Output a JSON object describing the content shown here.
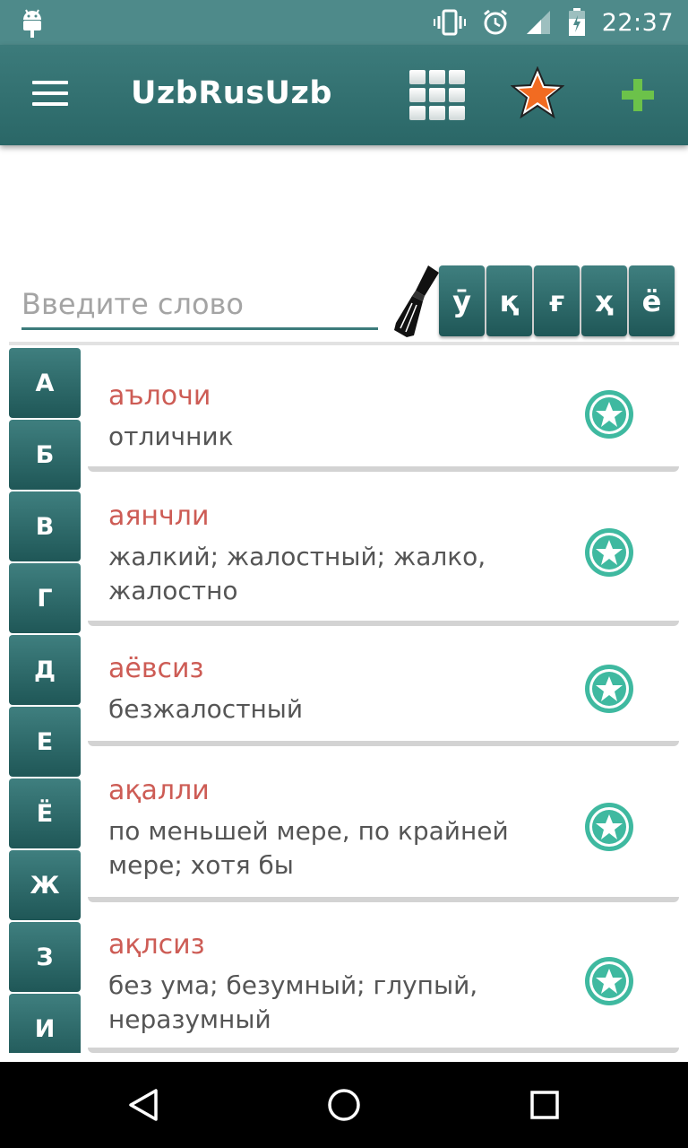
{
  "status_bar": {
    "time": "22:37",
    "icons": [
      "android-icon",
      "vibrate-icon",
      "alarm-icon",
      "signal-icon",
      "battery-icon"
    ]
  },
  "app_bar": {
    "title": "UzbRusUzb",
    "icons": [
      "menu-icon",
      "grid-icon",
      "favorites-star-icon",
      "add-plus-icon"
    ],
    "colors": {
      "bar": "#2f6d6d",
      "plus": "#6cc24a",
      "star": "#f26b21"
    }
  },
  "search": {
    "placeholder": "Введите слово",
    "value": "",
    "letter_keys": [
      "ӯ",
      "қ",
      "ғ",
      "ҳ",
      "ё"
    ]
  },
  "alphabet": [
    "А",
    "Б",
    "В",
    "Г",
    "Д",
    "Е",
    "Ё",
    "Ж",
    "З",
    "И"
  ],
  "entries": [
    {
      "word": "аълочи",
      "translation": "отличник"
    },
    {
      "word": "аянчли",
      "translation": "жалкий; жалостный; жалко, жалостно"
    },
    {
      "word": "аёвсиз",
      "translation": "безжалостный"
    },
    {
      "word": "ақалли",
      "translation": "по меньшей мере, по крайней мере; хотя бы"
    },
    {
      "word": "ақлсиз",
      "translation": "без ума; безумный; глупый, неразумный"
    }
  ],
  "colors": {
    "accent": "#3c7b7b",
    "word": "#cd5c55",
    "fav_circle": "#3fb9a0"
  },
  "nav_bar": {
    "icons": [
      "back-icon",
      "home-icon",
      "recents-icon"
    ]
  }
}
